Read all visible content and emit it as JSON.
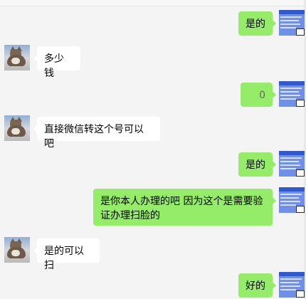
{
  "chat": {
    "messages": [
      {
        "side": "out",
        "text": "是的",
        "avatar": "avatar-blue-screenshot"
      },
      {
        "side": "in",
        "text": "多少钱",
        "avatar": "avatar-cat"
      },
      {
        "side": "out",
        "text": "0",
        "avatar": "avatar-blue-screenshot"
      },
      {
        "side": "in",
        "text": "直接微信转这个号可以吧",
        "avatar": "avatar-cat"
      },
      {
        "side": "out",
        "text": "是的",
        "avatar": "avatar-blue-screenshot"
      },
      {
        "side": "out",
        "text": "是你本人办理的吧  因为这个是需要验证办理扫脸的",
        "avatar": "avatar-blue-screenshot"
      },
      {
        "side": "in",
        "text": "是的可以扫",
        "avatar": "avatar-cat"
      },
      {
        "side": "out",
        "text": "好的",
        "avatar": "avatar-blue-screenshot"
      }
    ]
  },
  "colors": {
    "outgoing_bubble": "#95ec69",
    "incoming_bubble": "#ffffff",
    "background": "#f4f4f4"
  }
}
